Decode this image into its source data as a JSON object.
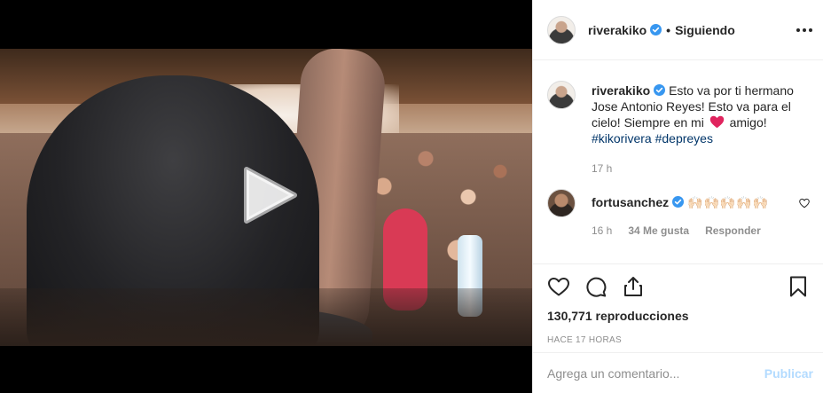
{
  "post": {
    "author": "riverakiko",
    "follow_status": "Siguiendo",
    "separator": "•",
    "verified": true
  },
  "caption": {
    "author": "riverakiko",
    "text_before_heart": "Esto va por ti hermano Jose Antonio Reyes! Esto va para el cielo! Siempre en mi",
    "heart_icon": "red-heart-emoji",
    "text_after_heart": "amigo!",
    "hashtags": [
      "#kikorivera",
      "#depreyes"
    ],
    "time": "17 h"
  },
  "comments": [
    {
      "author": "fortusanchez",
      "verified": true,
      "text": "🙌🏻🙌🏻🙌🏻🙌🏻🙌🏻",
      "time": "16 h",
      "likes": "34 Me gusta",
      "reply_label": "Responder"
    }
  ],
  "stats": {
    "views_count": "130,771",
    "views_label": "reproducciones",
    "time_ago": "HACE 17 HORAS"
  },
  "composer": {
    "placeholder": "Agrega un comentario...",
    "publish_label": "Publicar"
  },
  "colors": {
    "link": "#003569",
    "muted": "#8e8e8e",
    "verified_blue": "#3897f0",
    "publish_disabled": "#b3dbff",
    "heart": "#ed4956"
  },
  "icons": [
    "play-icon",
    "more-options-icon",
    "verified-icon",
    "like-icon",
    "comment-icon",
    "share-icon",
    "save-icon",
    "heart-outline-icon"
  ]
}
